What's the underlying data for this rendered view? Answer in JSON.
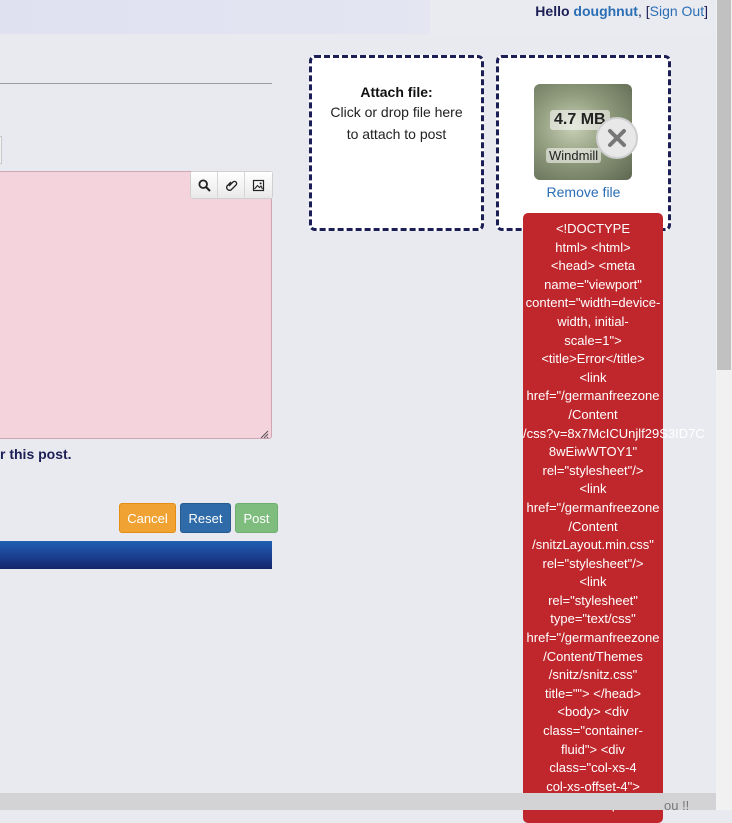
{
  "header": {
    "greeting_prefix": "Hello",
    "username": "doughnut",
    "comma": ",",
    "bracket_open": "[",
    "sign_out": "Sign Out",
    "bracket_close": "]"
  },
  "editor": {
    "toolbar": {
      "icons": [
        "search-icon",
        "paperclip-icon",
        "image-icon"
      ]
    },
    "note_text": "r this post."
  },
  "buttons": {
    "cancel": "Cancel",
    "reset": "Reset",
    "post": "Post"
  },
  "attach": {
    "title": "Attach file:",
    "hint_line1": "Click or drop file here",
    "hint_line2": "to attach to post"
  },
  "file_preview": {
    "size": "4.7 MB",
    "name": "Windmill",
    "remove_label": "Remove file"
  },
  "error_tooltip": {
    "text": "<!DOCTYPE\nhtml> <html>\n<head> <meta\nname=\"viewport\"\ncontent=\"width=device-\nwidth, initial-\nscale=1\">\n<title>Error</title>\n<link\nhref=\"/germanfreezone\n/Content\n/css?v=8x7McICUnjlf29S3ID7C\n8wEiwWTOY1\"\nrel=\"stylesheet\"/>\n<link\nhref=\"/germanfreezone\n/Content\n/snitzLayout.min.css\"\nrel=\"stylesheet\"/>\n<link\nrel=\"stylesheet\"\ntype=\"text/css\"\nhref=\"/germanfreezone\n/Content/Themes\n/snitz/snitz.css\"\ntitle=\"\"> </head>\n<body> <div\nclass=\"container-\nfluid\"> <div\nclass=\"col-xs-4\ncol-xs-offset-4\">\n<div class=\"panel"
  },
  "footer": {
    "fragment": "ou !!"
  },
  "colors": {
    "accent_navy": "#1c1f55",
    "link_blue": "#2a6eb5",
    "error_red": "#c0272d",
    "editor_pink": "#f4d3dd"
  }
}
